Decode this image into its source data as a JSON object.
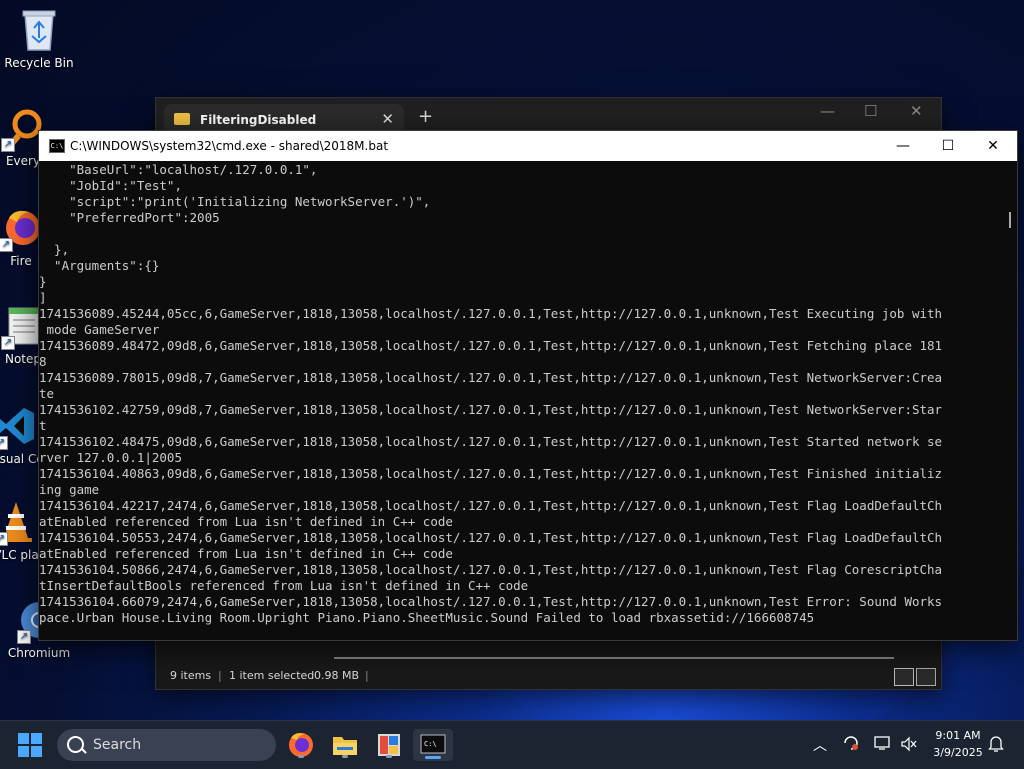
{
  "desktop": {
    "icons": [
      {
        "label": "Recycle Bin"
      },
      {
        "label": "Every"
      },
      {
        "label": "Fire"
      },
      {
        "label": "Notep"
      },
      {
        "label": "Visual Co"
      },
      {
        "label": "VLC pla"
      },
      {
        "label": "Chromium"
      }
    ]
  },
  "explorer": {
    "tab_title": "FilteringDisabled",
    "new_tab": "+",
    "status": {
      "items": "9 items",
      "selected": "1 item selected",
      "size": "0.98 MB"
    }
  },
  "cmd": {
    "title": "C:\\WINDOWS\\system32\\cmd.exe - shared\\2018M.bat",
    "icon_text": "C:\\",
    "lines": [
      "    \"BaseUrl\":\"localhost/.127.0.0.1\",",
      "    \"JobId\":\"Test\",",
      "    \"script\":\"print('Initializing NetworkServer.')\",",
      "    \"PreferredPort\":2005",
      "",
      "  },",
      "  \"Arguments\":{}",
      "}",
      "]",
      "1741536089.45244,05cc,6,GameServer,1818,13058,localhost/.127.0.0.1,Test,http://127.0.0.1,unknown,Test Executing job with",
      " mode GameServer",
      "1741536089.48472,09d8,6,GameServer,1818,13058,localhost/.127.0.0.1,Test,http://127.0.0.1,unknown,Test Fetching place 181",
      "8",
      "1741536089.78015,09d8,7,GameServer,1818,13058,localhost/.127.0.0.1,Test,http://127.0.0.1,unknown,Test NetworkServer:Crea",
      "te",
      "1741536102.42759,09d8,7,GameServer,1818,13058,localhost/.127.0.0.1,Test,http://127.0.0.1,unknown,Test NetworkServer:Star",
      "t",
      "1741536102.48475,09d8,6,GameServer,1818,13058,localhost/.127.0.0.1,Test,http://127.0.0.1,unknown,Test Started network se",
      "rver 127.0.0.1|2005",
      "1741536104.40863,09d8,6,GameServer,1818,13058,localhost/.127.0.0.1,Test,http://127.0.0.1,unknown,Test Finished initializ",
      "ing game",
      "1741536104.42217,2474,6,GameServer,1818,13058,localhost/.127.0.0.1,Test,http://127.0.0.1,unknown,Test Flag LoadDefaultCh",
      "atEnabled referenced from Lua isn't defined in C++ code",
      "1741536104.50553,2474,6,GameServer,1818,13058,localhost/.127.0.0.1,Test,http://127.0.0.1,unknown,Test Flag LoadDefaultCh",
      "atEnabled referenced from Lua isn't defined in C++ code",
      "1741536104.50866,2474,6,GameServer,1818,13058,localhost/.127.0.0.1,Test,http://127.0.0.1,unknown,Test Flag CorescriptCha",
      "tInsertDefaultBools referenced from Lua isn't defined in C++ code",
      "1741536104.66079,2474,6,GameServer,1818,13058,localhost/.127.0.0.1,Test,http://127.0.0.1,unknown,Test Error: Sound Works",
      "pace.Urban House.Living Room.Upright Piano.Piano.SheetMusic.Sound Failed to load rbxassetid://166608745"
    ]
  },
  "taskbar": {
    "search_label": "Search",
    "time": "9:01 AM",
    "date": "3/9/2025"
  },
  "colors": {
    "accent": "#5aa6ff",
    "terminal_bg": "#0c0c0c",
    "terminal_fg": "#cccccc"
  }
}
